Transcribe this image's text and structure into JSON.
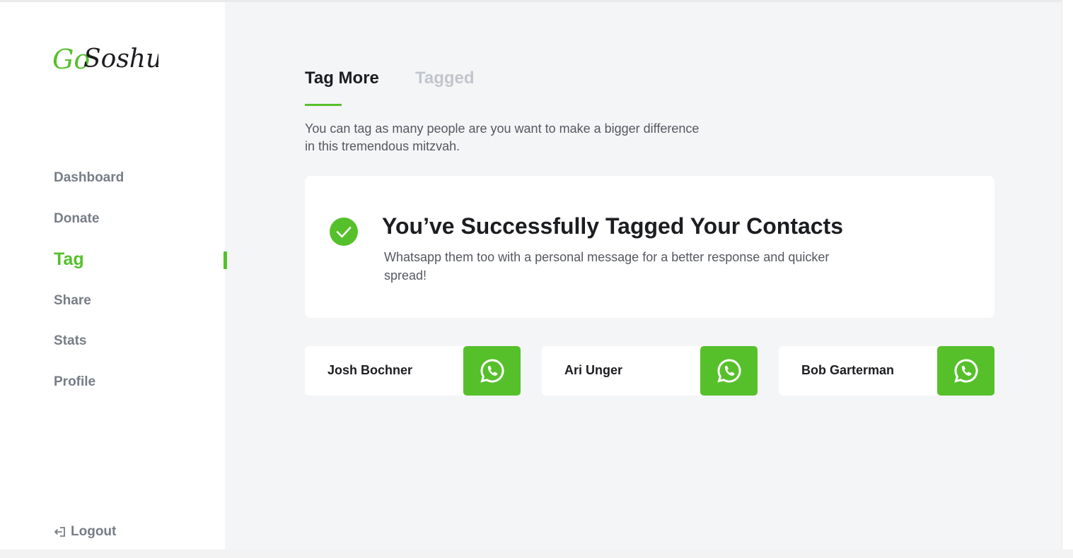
{
  "brand": {
    "logo_text": "GoSoshul",
    "accent_color": "#56c02b"
  },
  "sidebar": {
    "items": [
      {
        "label": "Dashboard",
        "active": false
      },
      {
        "label": "Donate",
        "active": false
      },
      {
        "label": "Tag",
        "active": true
      },
      {
        "label": "Share",
        "active": false
      },
      {
        "label": "Stats",
        "active": false
      },
      {
        "label": "Profile",
        "active": false
      }
    ],
    "logout_label": "Logout",
    "logout_icon": "logout-icon"
  },
  "tabs": [
    {
      "label": "Tag More",
      "active": true
    },
    {
      "label": "Tagged",
      "active": false
    }
  ],
  "intro_text": "You can tag as many people are you want to make a bigger difference in this tremendous mitzvah.",
  "success": {
    "icon": "check-circle-icon",
    "title": "You’ve Successfully Tagged Your Contacts",
    "subtitle": "Whatsapp them too with a personal message for a better response and quicker spread!"
  },
  "contacts": [
    {
      "name": "Josh Bochner",
      "action_icon": "whatsapp-icon"
    },
    {
      "name": "Ari Unger",
      "action_icon": "whatsapp-icon"
    },
    {
      "name": "Bob Garterman",
      "action_icon": "whatsapp-icon"
    }
  ]
}
